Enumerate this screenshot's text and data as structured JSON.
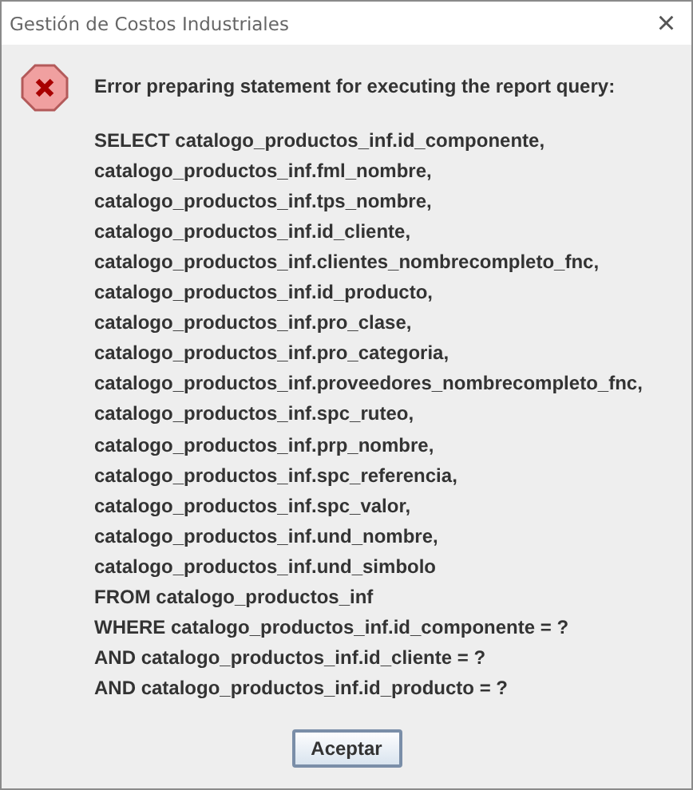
{
  "window": {
    "title": "Gestión de Costos Industriales",
    "close": "×"
  },
  "message": {
    "heading": "Error preparing statement for executing the report query:",
    "lines": [
      "SELECT catalogo_productos_inf.id_componente,",
      "catalogo_productos_inf.fml_nombre,",
      "catalogo_productos_inf.tps_nombre,",
      "catalogo_productos_inf.id_cliente,",
      "catalogo_productos_inf.clientes_nombrecompleto_fnc,",
      "catalogo_productos_inf.id_producto,",
      "catalogo_productos_inf.pro_clase,",
      "catalogo_productos_inf.pro_categoria,",
      "catalogo_productos_inf.proveedores_nombrecompleto_fnc,",
      "catalogo_productos_inf.spc_ruteo,",
      "catalogo_productos_inf.prp_nombre,",
      "catalogo_productos_inf.spc_referencia,",
      "catalogo_productos_inf.spc_valor,",
      "catalogo_productos_inf.und_nombre,",
      "catalogo_productos_inf.und_simbolo",
      "FROM catalogo_productos_inf",
      "WHERE  catalogo_productos_inf.id_componente =  ?",
      "AND catalogo_productos_inf.id_cliente =  ?",
      "AND catalogo_productos_inf.id_producto =  ?"
    ]
  },
  "buttons": [
    "Aceptar"
  ]
}
